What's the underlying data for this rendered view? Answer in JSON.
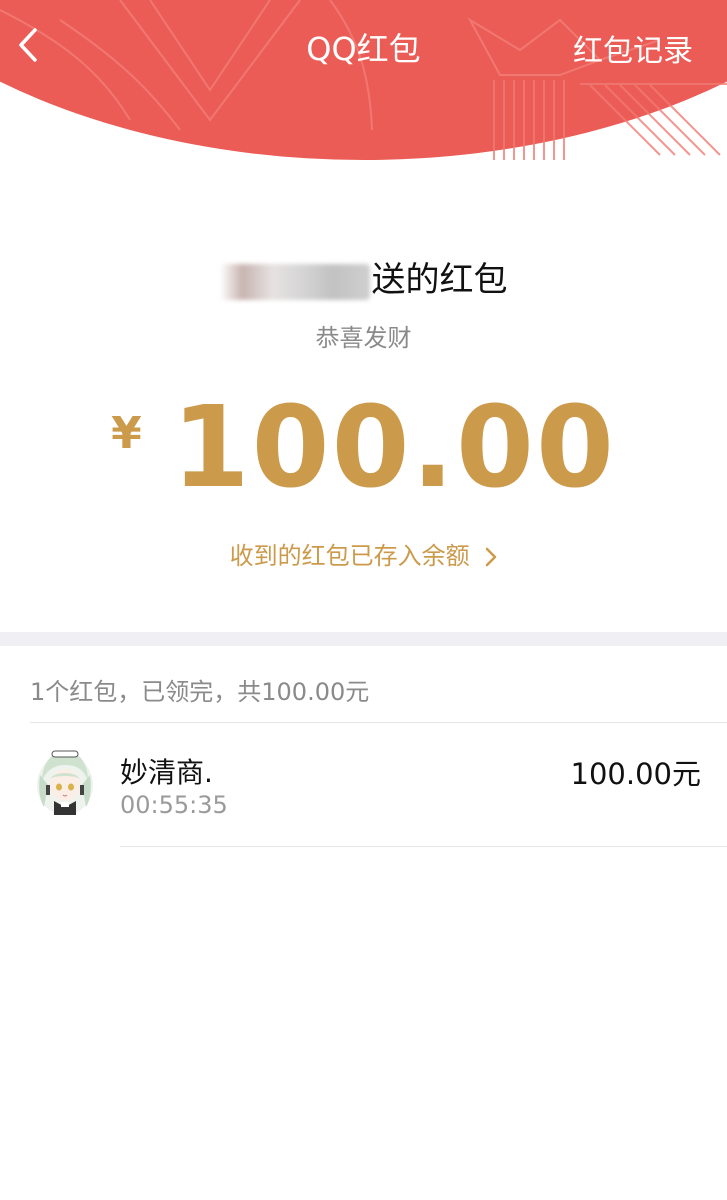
{
  "header": {
    "title": "QQ红包",
    "records_label": "红包记录",
    "back_icon": "chevron-left-icon",
    "bg_color": "#ec5c56"
  },
  "packet": {
    "sender_suffix": "送的红包",
    "greeting": "恭喜发财",
    "currency_symbol": "¥",
    "amount": "100.00",
    "deposit_note": "收到的红包已存入余额",
    "accent_color": "#cc9a4b"
  },
  "summary": {
    "text": "1个红包，已领完，共100.00元"
  },
  "claims": [
    {
      "name": "妙清商.",
      "time": "00:55:35",
      "amount": "100.00元",
      "avatar_icon": "anime-avatar-icon"
    }
  ]
}
